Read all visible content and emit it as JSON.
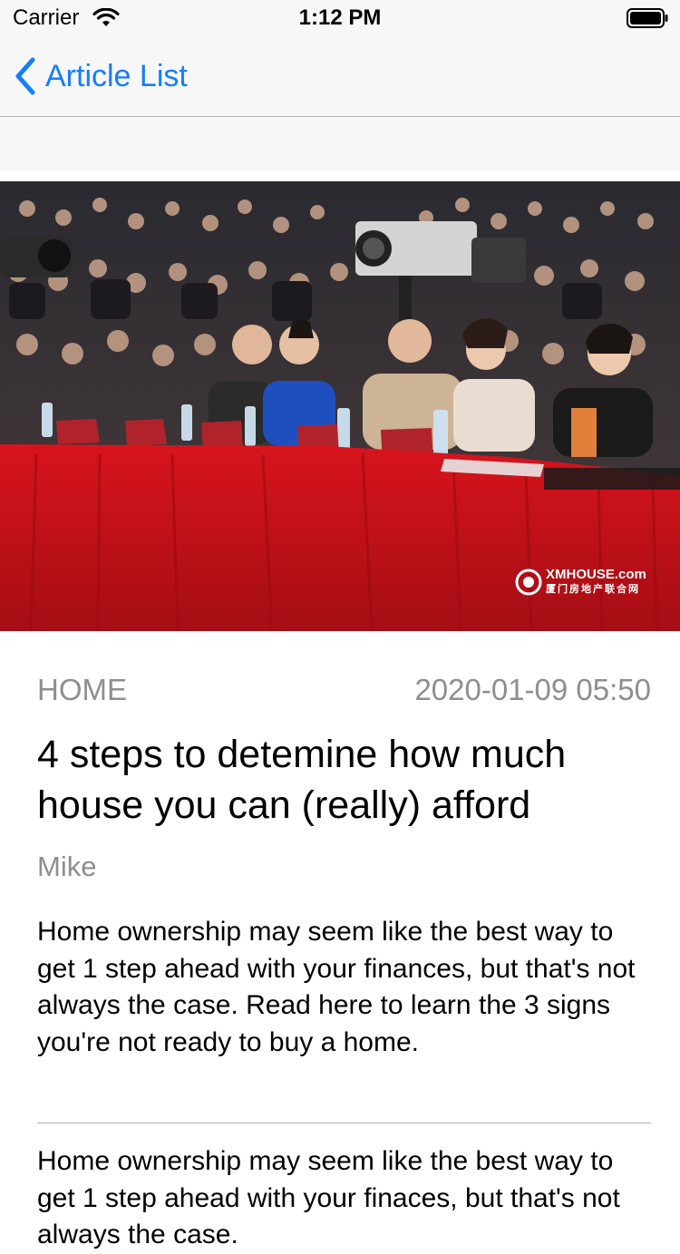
{
  "status_bar": {
    "carrier": "Carrier",
    "time": "1:12 PM"
  },
  "nav": {
    "back_label": "Article List"
  },
  "hero": {
    "watermark_brand": "XMHOUSE.com",
    "watermark_sub": "厦门房地产联合网"
  },
  "article": {
    "category": "HOME",
    "date": "2020-01-09 05:50",
    "title": "4 steps to detemine how much house you can (really) afford",
    "author": "Mike",
    "summary": "Home ownership may seem like the best way to get 1 step ahead with your finances, but that's not always the case. Read here to learn the 3 signs you're not ready to buy a home.",
    "body": "Home ownership may seem like the best way to get 1 step ahead with your finaces, but that's not always the case."
  },
  "colors": {
    "accent": "#147efb",
    "secondary_text": "#8e8e8e",
    "bar_background": "#f7f7f7",
    "tablecloth": "#c8121a"
  },
  "icons": {
    "wifi": "wifi-icon",
    "battery": "battery-icon",
    "back": "chevron-left-icon"
  }
}
